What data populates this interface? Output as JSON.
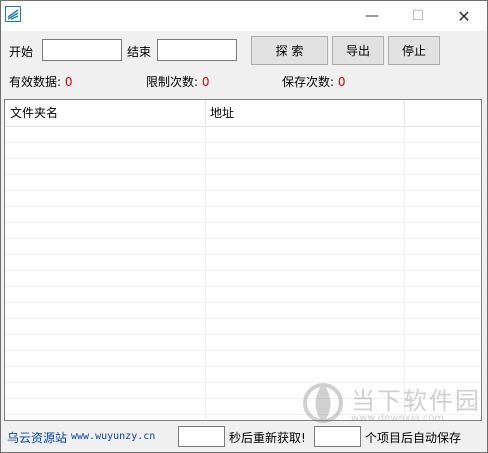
{
  "window": {
    "controls": {
      "minimize": "—",
      "maximize": "☐",
      "close": "✕"
    }
  },
  "search": {
    "start_label": "开始",
    "start_value": "",
    "end_label": "结束",
    "end_value": "",
    "search_button": "探 索",
    "export_button": "导出",
    "stop_button": "停止"
  },
  "stats": {
    "valid_label": "有效数据:",
    "valid_value": "0",
    "limit_label": "限制次数:",
    "limit_value": "0",
    "save_label": "保存次数:",
    "save_value": "0"
  },
  "table": {
    "columns": [
      "文件夹名",
      "地址",
      ""
    ],
    "rows": []
  },
  "footer": {
    "site_name": "乌云资源站",
    "site_url": "www.wuyunzy.cn",
    "interval_value": "",
    "interval_label": "秒后重新获取!",
    "autosave_value": "",
    "autosave_label": "个项目后自动保存"
  },
  "watermark": {
    "title": "当下软件园",
    "url": "www.downxia.com"
  },
  "colors": {
    "count_red": "#d00000",
    "link_blue": "#0645ad",
    "icon_teal": "#1e7fa8"
  }
}
